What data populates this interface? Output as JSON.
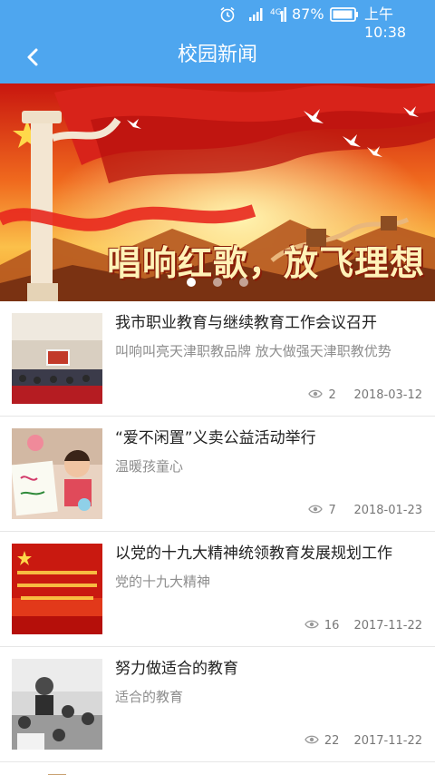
{
  "status_bar": {
    "battery": "87%",
    "time": "上午10:38"
  },
  "header": {
    "title": "校园新闻"
  },
  "banner": {
    "headline": "唱响红歌，放飞理想",
    "slide_count": 3,
    "active_slide": 1
  },
  "news": [
    {
      "title": "我市职业教育与继续教育工作会议召开",
      "subtitle": "叫响叫亮天津职教品牌 放大做强天津职教优势",
      "views": "2",
      "date": "2018-03-12"
    },
    {
      "title": "“爱不闲置”义卖公益活动举行",
      "subtitle": "温暖孩童心",
      "views": "7",
      "date": "2018-01-23"
    },
    {
      "title": "以党的十九大精神统领教育发展规划工作",
      "subtitle": "党的十九大精神",
      "views": "16",
      "date": "2017-11-22"
    },
    {
      "title": "努力做适合的教育",
      "subtitle": "适合的教育",
      "views": "22",
      "date": "2017-11-22"
    }
  ],
  "colors": {
    "header": "#4ea6ef",
    "banner_red": "#d8231a"
  }
}
